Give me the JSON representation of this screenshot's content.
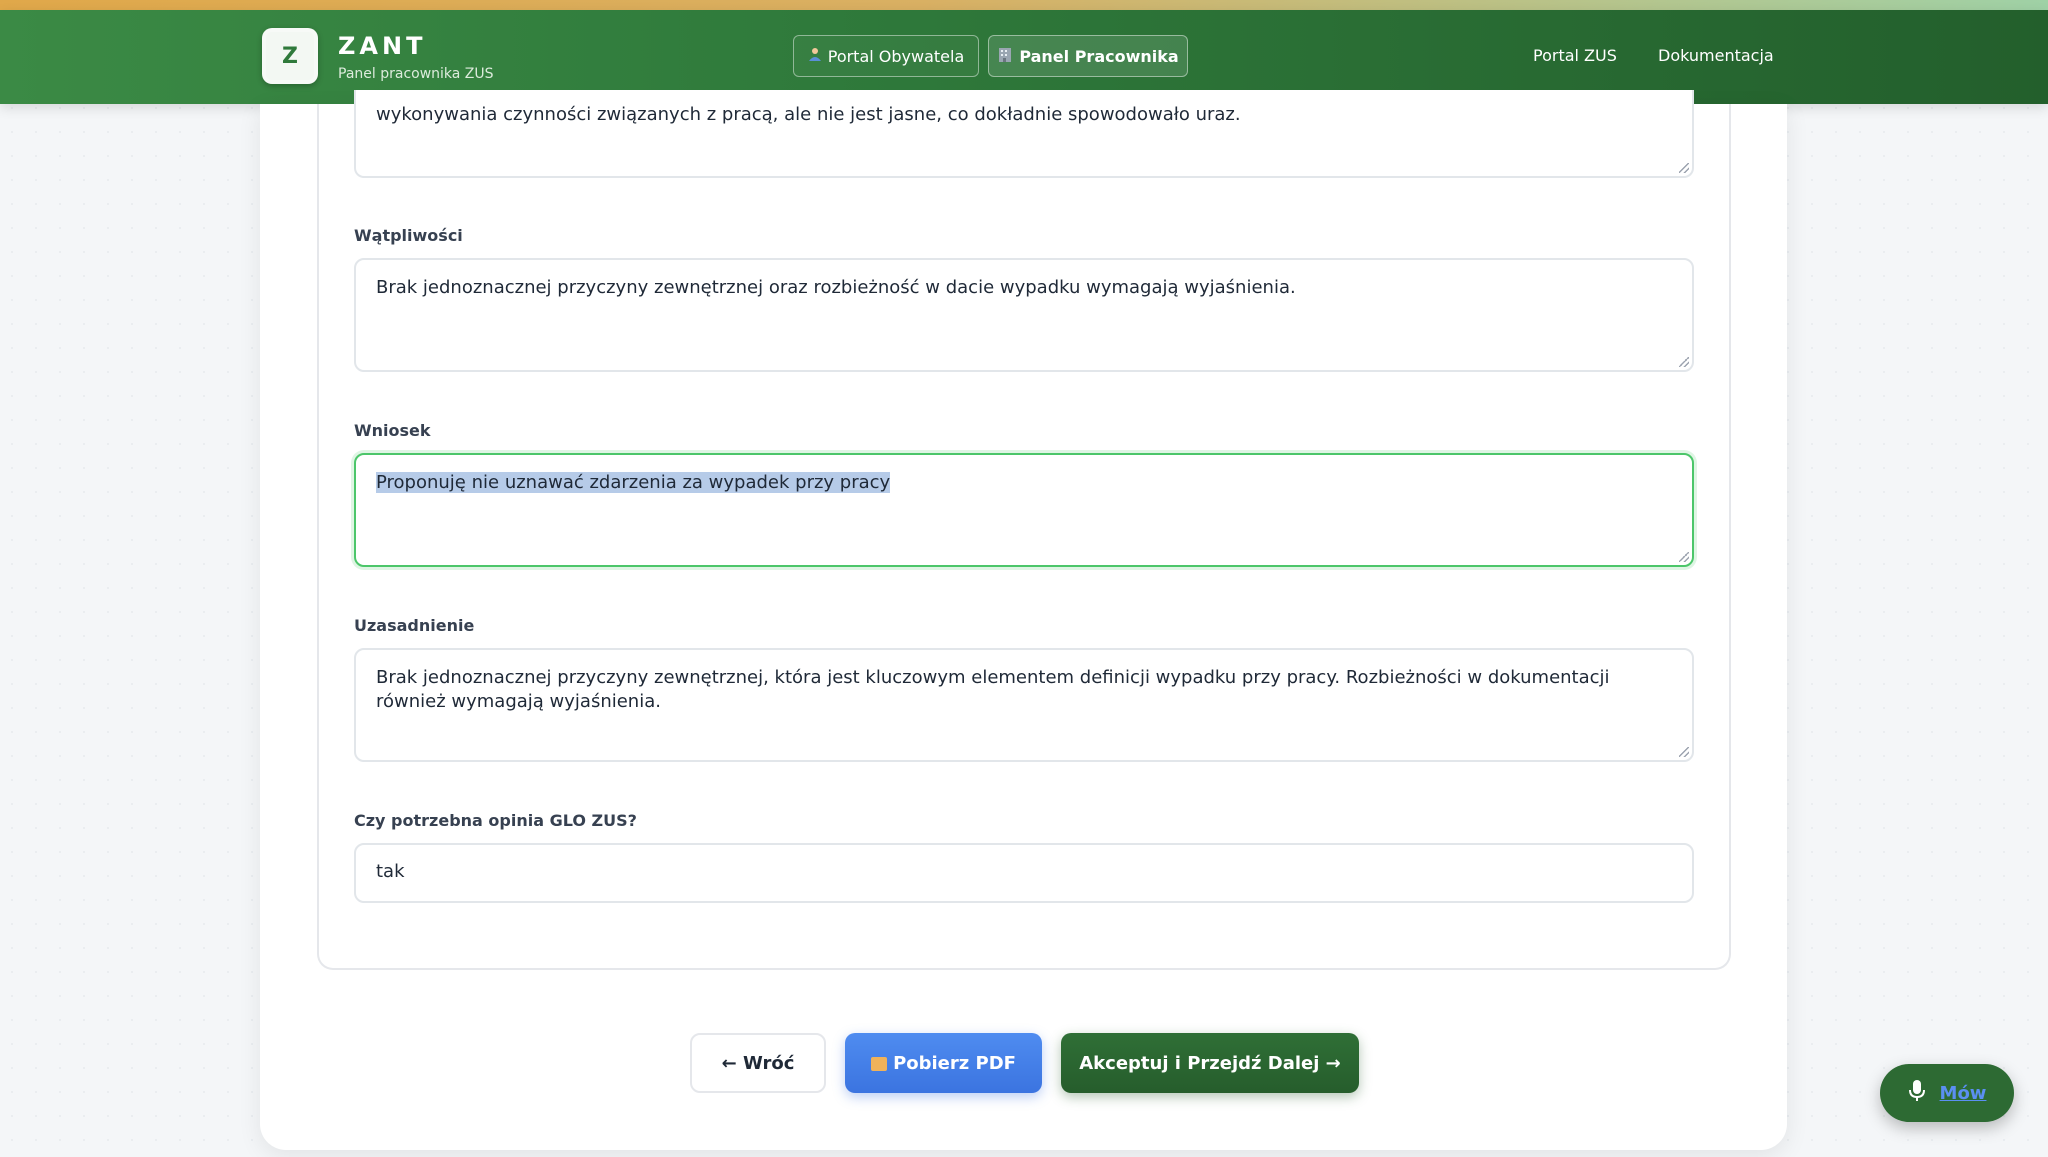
{
  "header": {
    "logo_letter": "Z",
    "brand_title": "ZANT",
    "brand_subtitle": "Panel pracownika ZUS",
    "portal_citizen": "Portal Obywatela",
    "portal_worker": "Panel Pracownika",
    "nav_portal_zus": "Portal ZUS",
    "nav_docs": "Dokumentacja"
  },
  "form": {
    "top_field_text": "wykonywania czynności związanych z pracą, ale nie jest jasne, co dokładnie spowodowało uraz.",
    "doubts": {
      "label": "Wątpliwości",
      "value": "Brak jednoznacznej przyczyny zewnętrznej oraz rozbieżność w dacie wypadku wymagają wyjaśnienia."
    },
    "request": {
      "label": "Wniosek",
      "value": "Proponuję nie uznawać zdarzenia za wypadek przy pracy"
    },
    "justification": {
      "label": "Uzasadnienie",
      "value": "Brak jednoznacznej przyczyny zewnętrznej, która jest kluczowym elementem definicji wypadku przy pracy. Rozbieżności w dokumentacji również wymagają wyjaśnienia."
    },
    "glo_opinion": {
      "label": "Czy potrzebna opinia GLO ZUS?",
      "value": "tak"
    }
  },
  "actions": {
    "back": "← Wróć",
    "download_pdf": "Pobierz PDF",
    "accept_next": "Akceptuj i Przejdź Dalej →"
  },
  "voice": {
    "label": "Mów"
  },
  "colors": {
    "header_green": "#2f7a3b",
    "accept_green": "#265d2c",
    "pdf_blue": "#3b74e0",
    "focus_green": "#4cc66a"
  }
}
